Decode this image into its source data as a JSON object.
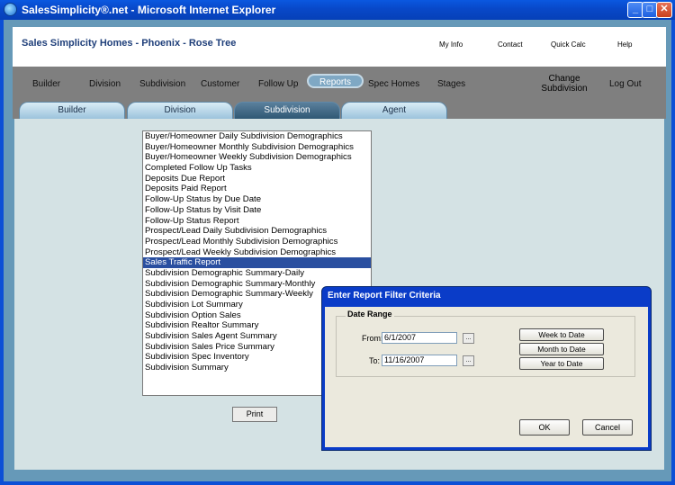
{
  "window": {
    "title": "SalesSimplicity®.net - Microsoft Internet Explorer",
    "buttons": {
      "minimize": "_",
      "maximize": "□",
      "close": "✕"
    }
  },
  "header": {
    "site_title": "Sales Simplicity Homes - Phoenix - Rose Tree",
    "links": [
      "My Info",
      "Contact",
      "Quick Calc",
      "Help"
    ]
  },
  "nav": {
    "items": [
      "Builder",
      "Division",
      "Subdivision",
      "Customer",
      "Follow Up",
      "Reports",
      "Spec Homes",
      "Stages"
    ],
    "active": "Reports",
    "change_subdivision": "Change Subdivision",
    "logout": "Log Out"
  },
  "tabs": {
    "items": [
      "Builder",
      "Division",
      "Subdivision",
      "Agent"
    ],
    "active": "Subdivision"
  },
  "reports": {
    "items": [
      "Buyer/Homeowner Daily Subdivision Demographics",
      "Buyer/Homeowner Monthly Subdivision Demographics",
      "Buyer/Homeowner Weekly Subdivision Demographics",
      "Completed Follow Up Tasks",
      "Deposits Due Report",
      "Deposits Paid Report",
      "Follow-Up Status by Due Date",
      "Follow-Up Status by Visit Date",
      "Follow-Up Status Report",
      "Prospect/Lead Daily Subdivision Demographics",
      "Prospect/Lead Monthly Subdivision Demographics",
      "Prospect/Lead Weekly Subdivision Demographics",
      "Sales Traffic Report",
      "Subdivision Demographic Summary-Daily",
      "Subdivision Demographic Summary-Monthly",
      "Subdivision Demographic Summary-Weekly",
      "Subdivision Lot Summary",
      "Subdivision Option Sales",
      "Subdivision Realtor Summary",
      "Subdivision Sales Agent Summary",
      "Subdivision Sales Price Summary",
      "Subdivision Spec Inventory",
      "Subdivision Summary"
    ],
    "selected": "Sales Traffic Report",
    "print_label": "Print"
  },
  "dialog": {
    "title": "Enter Report Filter Criteria",
    "group_label": "Date Range",
    "from_label": "From:",
    "from_value": "6/1/2007",
    "to_label": "To:",
    "to_value": "11/16/2007",
    "calendar_button": "...",
    "week_to_date": "Week to Date",
    "month_to_date": "Month to Date",
    "year_to_date": "Year to Date",
    "ok": "OK",
    "cancel": "Cancel"
  },
  "colors": {
    "titlebar": "#0a58e0",
    "nav_bg": "#7f7f7f",
    "content_bg": "#d4e2e4",
    "selection": "#2a4fa0",
    "dialog_title": "#0a3cc8"
  }
}
